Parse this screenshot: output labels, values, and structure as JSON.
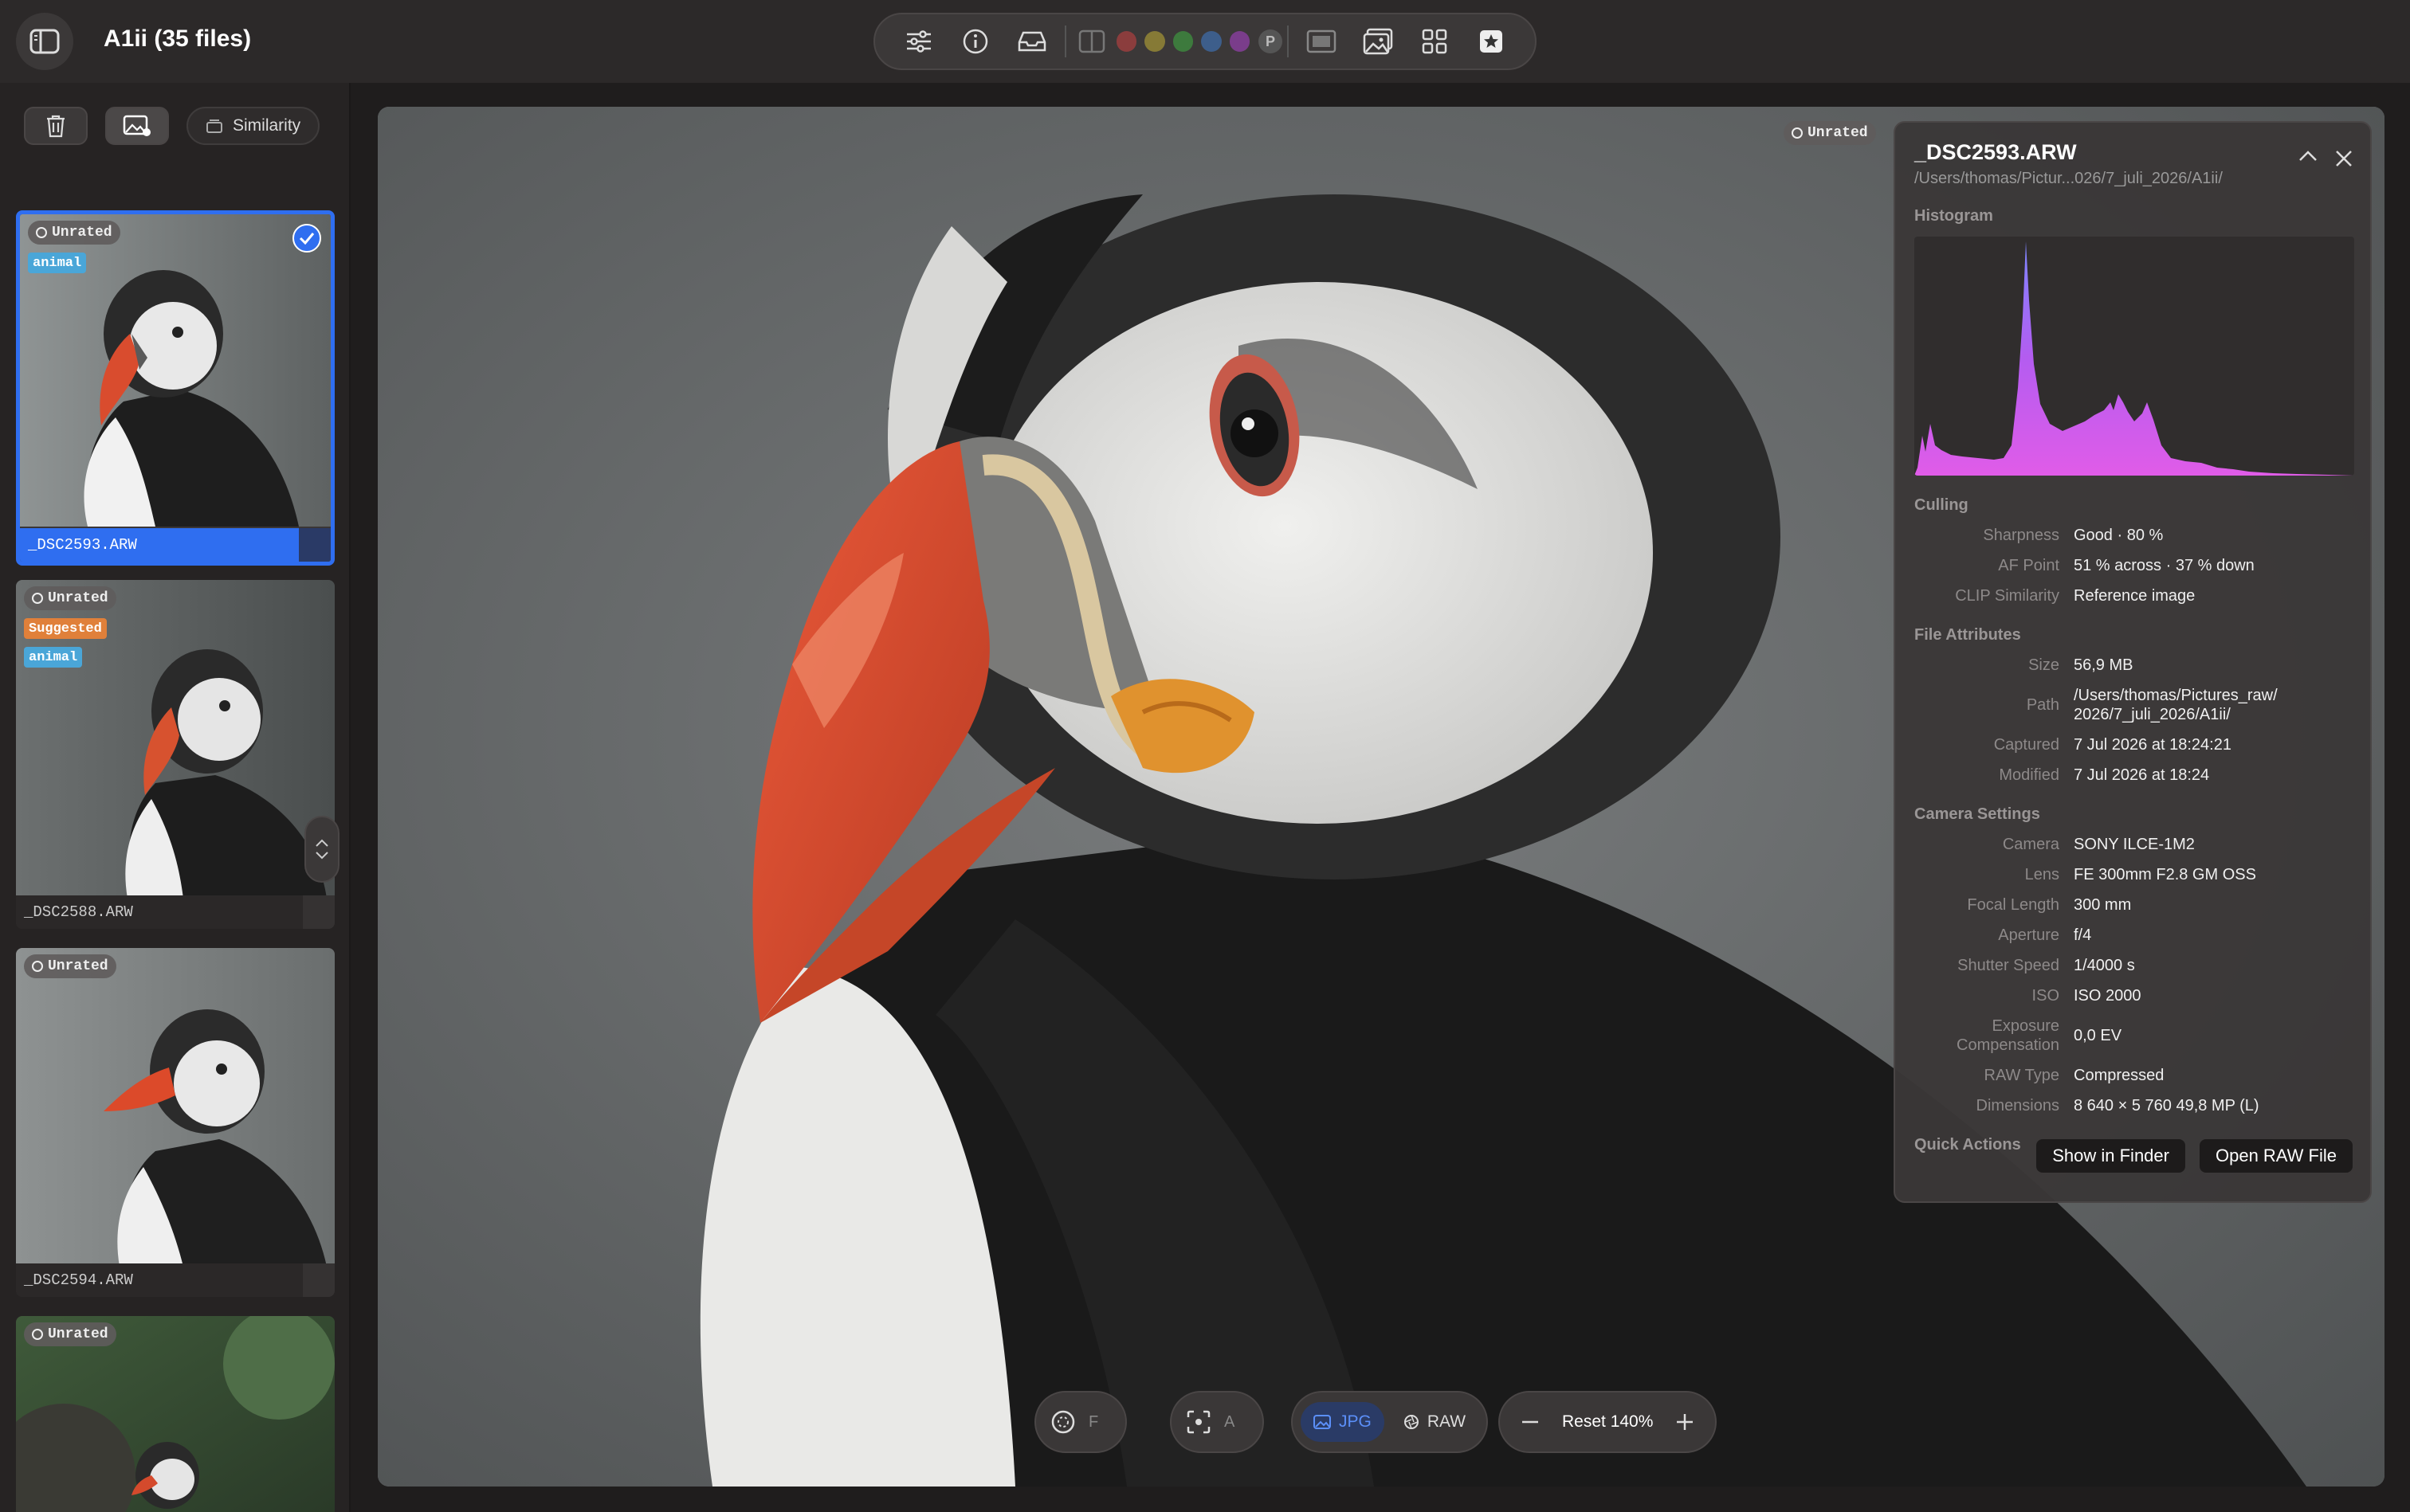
{
  "app": {
    "title": "A1ii (35 files)"
  },
  "toolbar": {
    "colors": [
      "#8b3d3d",
      "#867a36",
      "#3d7a3d",
      "#3d5e8b",
      "#7a3d8b"
    ],
    "p_label": "P"
  },
  "sidebar": {
    "similarity_label": "Similarity",
    "thumbs": [
      {
        "rating": "Unrated",
        "tags": [
          "animal"
        ],
        "name": "_DSC2593.ARW",
        "selected": true
      },
      {
        "rating": "Unrated",
        "tags": [
          "Suggested",
          "animal"
        ],
        "name": "_DSC2588.ARW"
      },
      {
        "rating": "Unrated",
        "tags": [],
        "name": "_DSC2594.ARW"
      },
      {
        "rating": "Unrated",
        "tags": [],
        "name": ""
      }
    ]
  },
  "viewer": {
    "rating": "Unrated"
  },
  "info": {
    "filename": "_DSC2593.ARW",
    "path_short": "/Users/thomas/Pictur...026/7_juli_2026/A1ii/",
    "histogram_label": "Histogram",
    "culling": {
      "title": "Culling",
      "rows": [
        {
          "k": "Sharpness",
          "v": "Good · 80 %"
        },
        {
          "k": "AF Point",
          "v": "51 % across · 37 % down"
        },
        {
          "k": "CLIP Similarity",
          "v": "Reference image"
        }
      ]
    },
    "file": {
      "title": "File Attributes",
      "size_k": "Size",
      "size_v": "56,9 MB",
      "path_k": "Path",
      "path_v1": "/Users/thomas/Pictures_raw/",
      "path_v2": "2026/7_juli_2026/A1ii/",
      "captured_k": "Captured",
      "captured_v": "7 Jul 2026 at 18:24:21",
      "modified_k": "Modified",
      "modified_v": "7 Jul 2026 at 18:24"
    },
    "camera": {
      "title": "Camera Settings",
      "rows": [
        {
          "k": "Camera",
          "v": "SONY ILCE-1M2"
        },
        {
          "k": "Lens",
          "v": "FE 300mm F2.8 GM OSS"
        },
        {
          "k": "Focal Length",
          "v": "300 mm"
        },
        {
          "k": "Aperture",
          "v": "f/4"
        },
        {
          "k": "Shutter Speed",
          "v": "1/4000 s"
        },
        {
          "k": "ISO",
          "v": "ISO 2000"
        }
      ],
      "ev_k1": "Exposure",
      "ev_k2": "Compensation",
      "ev_v": "0,0 EV",
      "rows2": [
        {
          "k": "RAW Type",
          "v": "Compressed"
        },
        {
          "k": "Dimensions",
          "v": "8 640 × 5 760  49,8 MP (L)"
        }
      ]
    },
    "quick": {
      "title": "Quick Actions",
      "finder": "Show in Finder",
      "open_raw": "Open RAW File"
    }
  },
  "bottom": {
    "focus_key": "F",
    "af_key": "A",
    "jpg": "JPG",
    "raw": "RAW",
    "zoom": "Reset 140%"
  }
}
